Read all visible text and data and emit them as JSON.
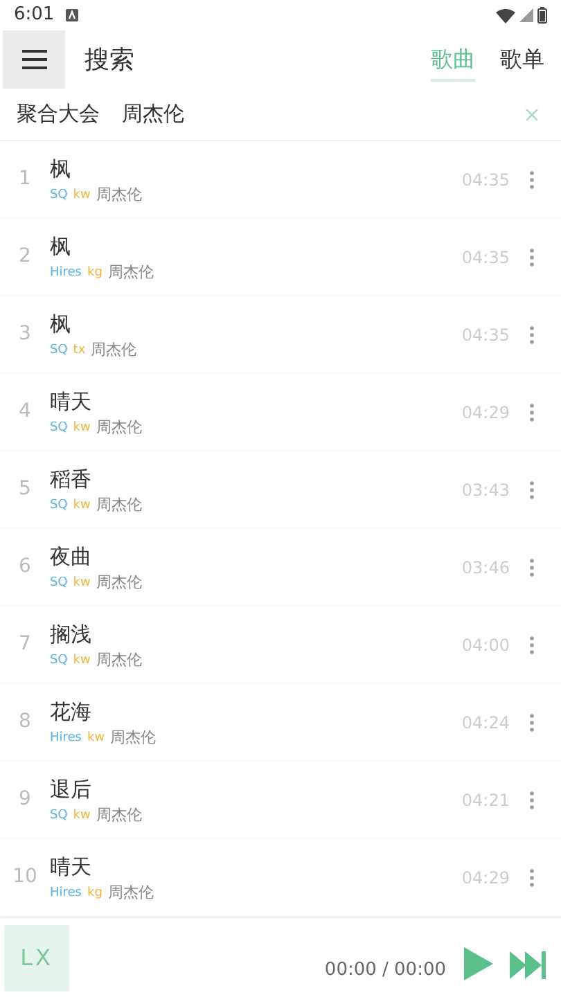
{
  "status_bar": {
    "time": "6:01"
  },
  "header": {
    "title": "搜索",
    "tabs": [
      {
        "label": "歌曲",
        "selected": true
      },
      {
        "label": "歌单",
        "selected": false
      }
    ]
  },
  "search": {
    "source": "聚合大会",
    "value": "周杰伦"
  },
  "songs": [
    {
      "index": "1",
      "title": "枫",
      "quality": "SQ",
      "source": "kw",
      "artist": "周杰伦",
      "duration": "04:35"
    },
    {
      "index": "2",
      "title": "枫",
      "quality": "Hires",
      "source": "kg",
      "artist": "周杰伦",
      "duration": "04:35"
    },
    {
      "index": "3",
      "title": "枫",
      "quality": "SQ",
      "source": "tx",
      "artist": "周杰伦",
      "duration": "04:35"
    },
    {
      "index": "4",
      "title": "晴天",
      "quality": "SQ",
      "source": "kw",
      "artist": "周杰伦",
      "duration": "04:29"
    },
    {
      "index": "5",
      "title": "稻香",
      "quality": "SQ",
      "source": "kw",
      "artist": "周杰伦",
      "duration": "03:43"
    },
    {
      "index": "6",
      "title": "夜曲",
      "quality": "SQ",
      "source": "kw",
      "artist": "周杰伦",
      "duration": "03:46"
    },
    {
      "index": "7",
      "title": "搁浅",
      "quality": "SQ",
      "source": "kw",
      "artist": "周杰伦",
      "duration": "04:00"
    },
    {
      "index": "8",
      "title": "花海",
      "quality": "Hires",
      "source": "kw",
      "artist": "周杰伦",
      "duration": "04:24"
    },
    {
      "index": "9",
      "title": "退后",
      "quality": "SQ",
      "source": "kw",
      "artist": "周杰伦",
      "duration": "04:21"
    },
    {
      "index": "10",
      "title": "晴天",
      "quality": "Hires",
      "source": "kg",
      "artist": "周杰伦",
      "duration": "04:29"
    }
  ],
  "player": {
    "cover": "LX",
    "time": "00:00 / 00:00"
  }
}
